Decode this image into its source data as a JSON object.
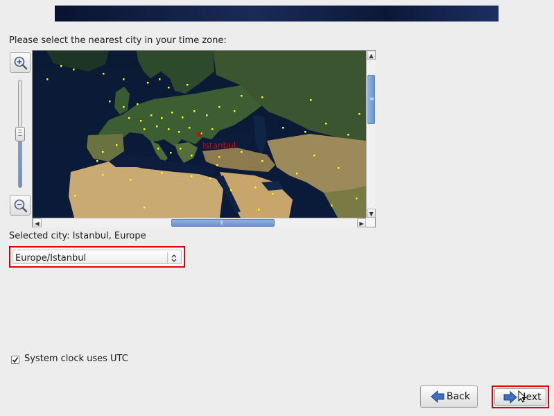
{
  "header": {
    "banner_colors": [
      "#0a1330",
      "#1c2f63"
    ]
  },
  "prompt": "Please select the nearest city in your time zone:",
  "map": {
    "selected_marker_label": "Istanbul",
    "marker_color": "#ffff00",
    "selected_color": "#e00000",
    "icons": {
      "zoom_in": "zoom-in-icon",
      "zoom_out": "zoom-out-icon"
    }
  },
  "selected_city": "Selected city: Istanbul, Europe",
  "timezone_select": {
    "value": "Europe/Istanbul"
  },
  "utc": {
    "checked": true,
    "label": "System clock uses UTC"
  },
  "nav": {
    "back_label": "Back",
    "next_label": "Next"
  },
  "highlight_color": "#e00000"
}
